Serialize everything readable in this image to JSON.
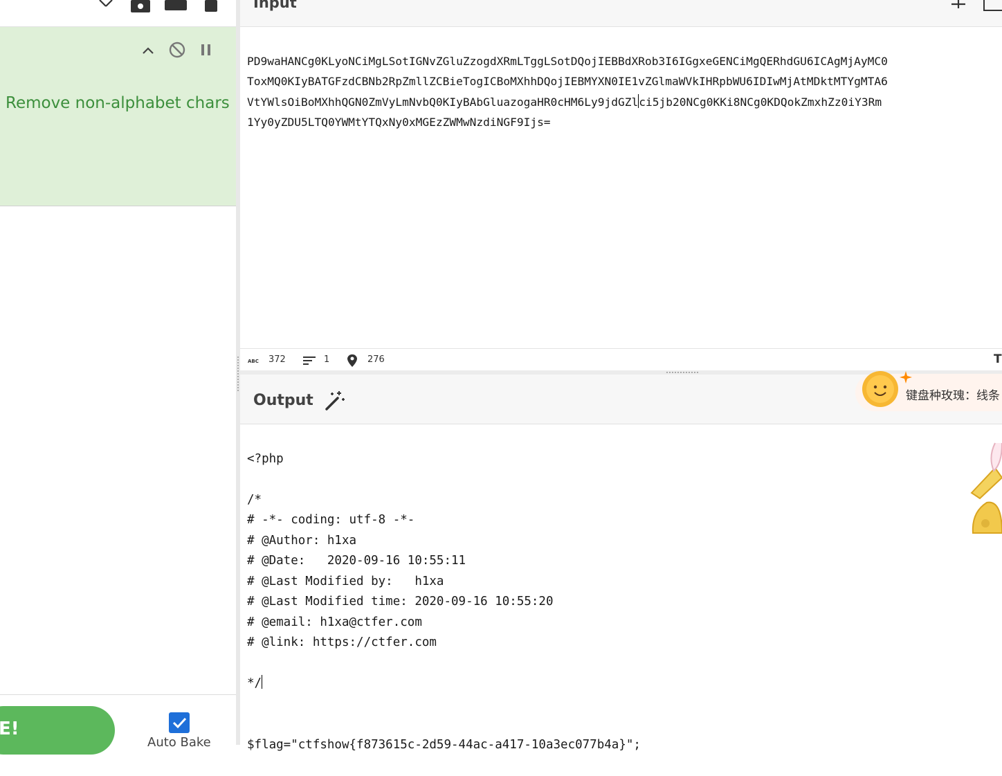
{
  "recipe": {
    "operation": {
      "title": "Remove non-alphabet chars"
    },
    "bake_label": "E!",
    "auto_bake_label": "Auto Bake",
    "auto_bake_checked": true
  },
  "input": {
    "title": "Input",
    "lines": [
      "PD9waHANCg0KLyoNCiMgLSotIGNvZGluZzogdXRmLTggLSotDQojIEBBdXRob3I6IGgxeGENCiMgQERhdGU6ICAgMjAyMC0",
      "ToxMQ0KIyBATGFzdCBNb2RpZmllZCBieTogICBoMXhhDQojIEBMYXN0IE1vZGlmaWVkIHRpbWU6IDIwMjAtMDktMTYgMTA6",
      "VtYWlsOiBoMXhhQGN0ZmVyLmNvbQ0KIyBAbGluazogaHR0cHM6Ly9jdGZl",
      "ci5jb20NCg0KKi8NCg0KDQokZmxhZz0iY3Rm",
      "1Yy0yZDU5LTQ0YWMtYTQxNy0xMGEzZWMwNzdiNGF9Ijs="
    ],
    "status": {
      "length": "372",
      "lines": "1",
      "position": "276",
      "t_label": "T"
    }
  },
  "output": {
    "title": "Output",
    "lines": [
      "<?php",
      "",
      "/*",
      "# -*- coding: utf-8 -*-",
      "# @Author: h1xa",
      "# @Date:   2020-09-16 10:55:11",
      "# @Last Modified by:   h1xa",
      "# @Last Modified time: 2020-09-16 10:55:20",
      "# @email: h1xa@ctfer.com",
      "# @link: https://ctfer.com",
      "",
      "*/",
      "",
      "",
      "$flag=\"ctfshow{f873615c-2d59-44ac-a417-10a3ec077b4a}\";"
    ]
  },
  "overlay": {
    "text": "键盘种玫瑰：线条"
  }
}
